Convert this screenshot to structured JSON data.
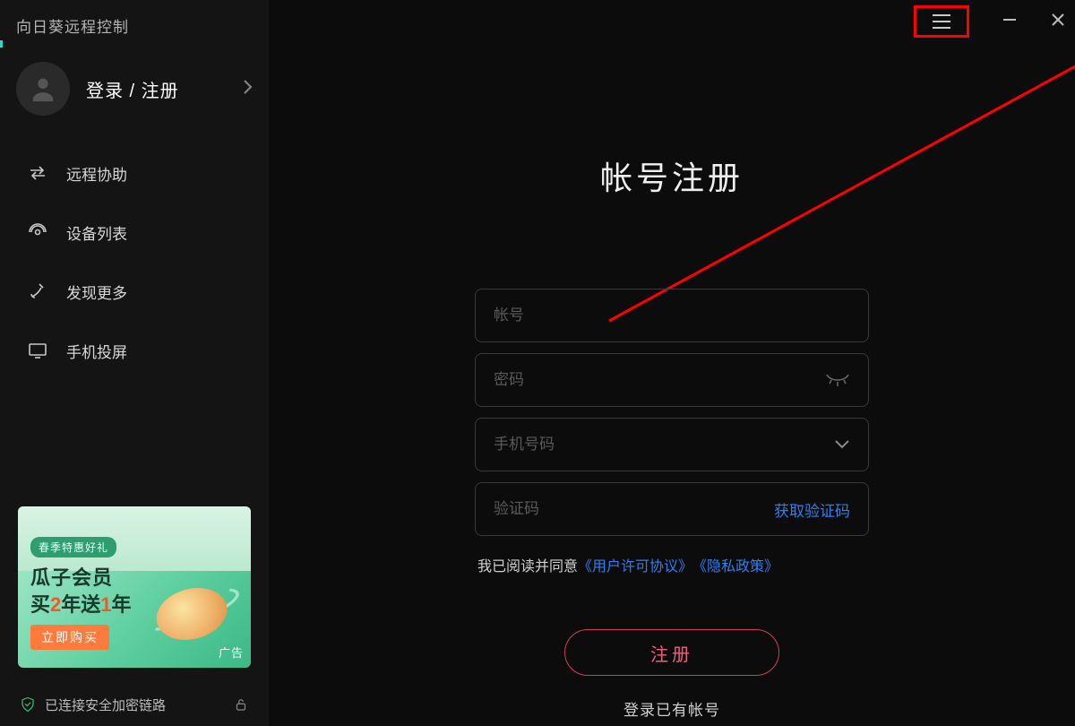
{
  "window": {
    "title": "向日葵远程控制"
  },
  "account": {
    "label": "登录 / 注册"
  },
  "sidebar": {
    "items": [
      {
        "label": "远程协助"
      },
      {
        "label": "设备列表"
      },
      {
        "label": "发现更多"
      },
      {
        "label": "手机投屏"
      }
    ]
  },
  "promo": {
    "pill": "春季特惠好礼",
    "line1": "瓜子会员",
    "line2_prefix": "买",
    "line2_num1": "2",
    "line2_mid": "年送",
    "line2_num2": "1",
    "line2_suffix": "年",
    "buy": "立即购买",
    "ad_tag": "广告"
  },
  "status": {
    "text": "已连接安全加密链路"
  },
  "form": {
    "title": "帐号注册",
    "account_placeholder": "帐号",
    "password_placeholder": "密码",
    "phone_placeholder": "手机号码",
    "code_placeholder": "验证码",
    "get_code": "获取验证码",
    "agree_prefix": "我已阅读并同意",
    "agreement": "《用户许可协议》",
    "privacy": "《隐私政策》",
    "register": "注册",
    "login_existing": "登录已有帐号"
  }
}
